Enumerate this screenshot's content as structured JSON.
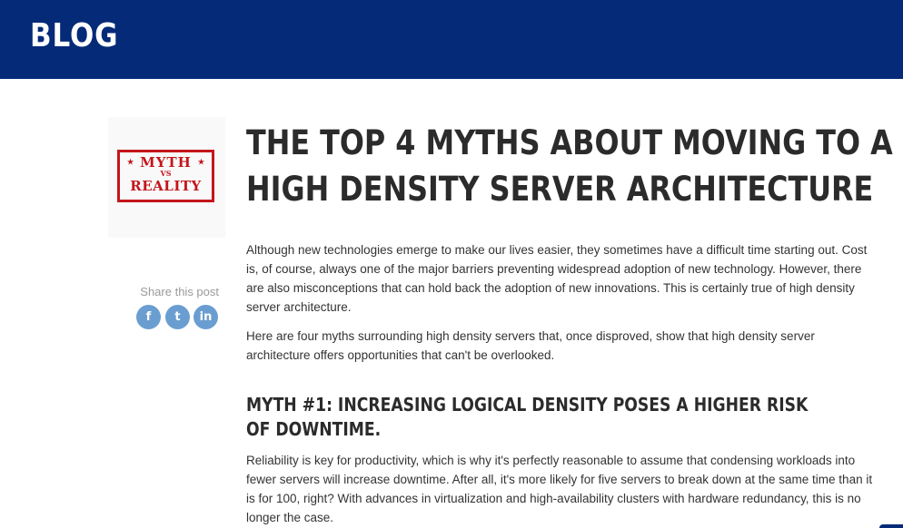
{
  "header": {
    "title": "BLOG"
  },
  "post": {
    "image": {
      "alt": "Myth vs Reality stamp",
      "stamp_top": "MYTH",
      "stamp_vs": "VS",
      "stamp_bottom": "REALITY",
      "color": "#c4161c"
    },
    "title_lines": [
      "THE TOP 4 MYTHS ABOUT MOVING TO A",
      "HIGH DENSITY SERVER ARCHITECTURE"
    ],
    "paragraphs": [
      "Although new technologies emerge to make our lives easier, they sometimes have a difficult time starting out. Cost is, of course, always one of the major barriers preventing widespread adoption of new technology. However, there are also misconceptions that can hold back the adoption of new innovations. This is certainly true of high density server architecture.",
      "Here are four myths surrounding high density servers that, once disproved, show that high density server architecture offers opportunities that can't be overlooked."
    ],
    "section": {
      "heading": "MYTH #1: INCREASING LOGICAL DENSITY POSES A HIGHER RISK OF DOWNTIME.",
      "paragraph": "Reliability is key for productivity, which is why it's perfectly reasonable to assume that condensing workloads into fewer servers will increase downtime. After all, it's more likely for five servers to break down at the same time than it is for 100, right? With advances in virtualization and high-availability clusters with hardware redundancy, this is no longer the case."
    }
  },
  "share": {
    "label": "Share this post",
    "buttons": [
      {
        "icon": "facebook-icon",
        "glyph": "f"
      },
      {
        "icon": "twitter-icon",
        "glyph": "t"
      },
      {
        "icon": "linkedin-icon",
        "glyph": "in"
      }
    ]
  },
  "colors": {
    "header_bg": "#042a78",
    "share_button": "#6a9ed1",
    "heading_text": "#2b2b2b",
    "body_text": "#333333"
  }
}
